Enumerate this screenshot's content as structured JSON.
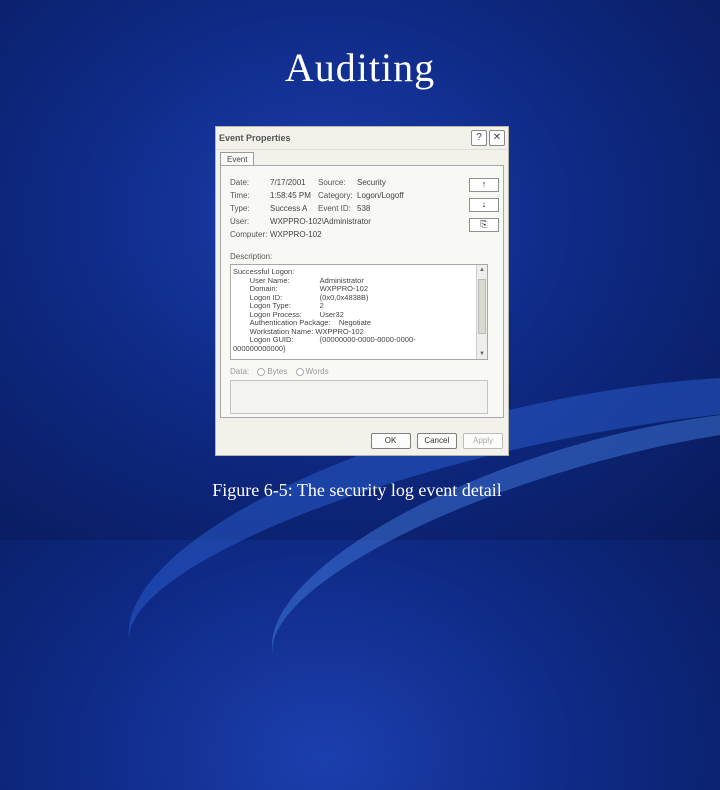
{
  "slide": {
    "title": "Auditing",
    "caption": "Figure 6-5: The security log event detail"
  },
  "dialog": {
    "title": "Event Properties",
    "help_label": "?",
    "close_label": "✕",
    "tab": "Event",
    "fields": {
      "date_label": "Date:",
      "date": "7/17/2001",
      "source_label": "Source:",
      "source": "Security",
      "time_label": "Time:",
      "time": "1:58:45 PM",
      "category_label": "Category:",
      "category": "Logon/Logoff",
      "type_label": "Type:",
      "type": "Success A",
      "event_id_label": "Event ID:",
      "event_id": "538",
      "user_label": "User:",
      "user": "WXPPRO-102\\Administrator",
      "computer_label": "Computer:",
      "computer": "WXPPRO-102"
    },
    "up_icon": "up-arrow-icon",
    "down_icon": "down-arrow-icon",
    "copy_icon": "copy-icon",
    "description_label": "Description:",
    "description": {
      "heading": "Successful Logon:",
      "lines": [
        {
          "k": "User Name:",
          "v": "Administrator"
        },
        {
          "k": "Domain:",
          "v": "WXPPRO-102"
        },
        {
          "k": "Logon ID:",
          "v": "(0x0,0x4838B)"
        },
        {
          "k": "Logon Type:",
          "v": "2"
        },
        {
          "k": "Logon Process:",
          "v": "User32"
        }
      ],
      "auth_package": "Authentication Package:",
      "auth_value": "Negotiate",
      "workstation": "Workstation Name: WXPPRO-102",
      "guid_label": "Logon GUID:",
      "guid_value": "{00000000-0000-0000-0000-",
      "guid_tail": "000000000000}"
    },
    "data_label": "Data:",
    "bytes_label": "Bytes",
    "words_label": "Words",
    "buttons": {
      "ok": "OK",
      "cancel": "Cancel",
      "apply": "Apply"
    }
  }
}
